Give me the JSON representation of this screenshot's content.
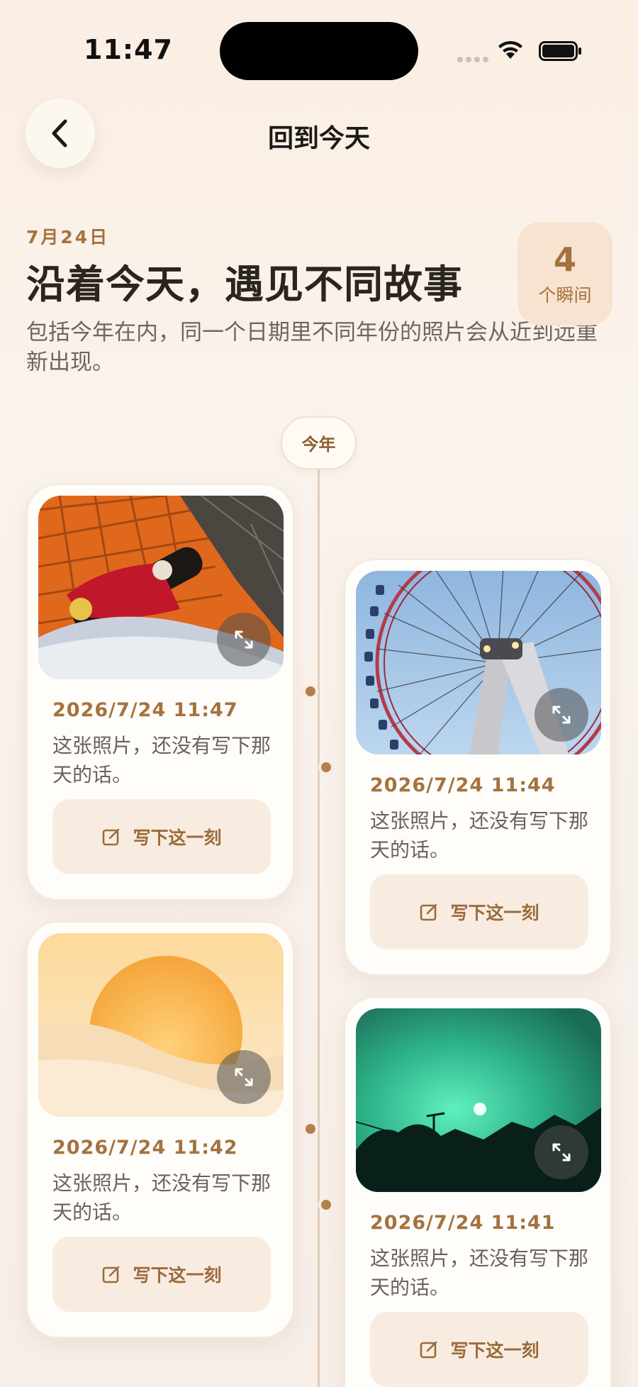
{
  "status_bar": {
    "time": "11:47"
  },
  "nav": {
    "title": "回到今天"
  },
  "header": {
    "date": "7月24日",
    "headline": "沿着今天，遇见不同故事",
    "subtitle": "包括今年在内，同一个日期里不同年份的照片会从近到远重新出现。",
    "count_number": "4",
    "count_unit": "个瞬间"
  },
  "timeline": {
    "year_label": "今年",
    "cards": [
      {
        "date": "2026/7/24 11:47",
        "note": "这张照片，还没有写下那天的话。",
        "button": "写下这一刻",
        "photo": "skateboard-photo"
      },
      {
        "date": "2026/7/24 11:44",
        "note": "这张照片，还没有写下那天的话。",
        "button": "写下这一刻",
        "photo": "ferris-wheel-photo"
      },
      {
        "date": "2026/7/24 11:42",
        "note": "这张照片，还没有写下那天的话。",
        "button": "写下这一刻",
        "photo": "sunset-illustration"
      },
      {
        "date": "2026/7/24 11:41",
        "note": "这张照片，还没有写下那天的话。",
        "button": "写下这一刻",
        "photo": "green-sky-photo"
      }
    ]
  },
  "colors": {
    "accent": "#a4723f",
    "card_bg": "#fffdfa",
    "button_bg": "#f8ece0",
    "badge_bg": "#f7e3cf"
  }
}
